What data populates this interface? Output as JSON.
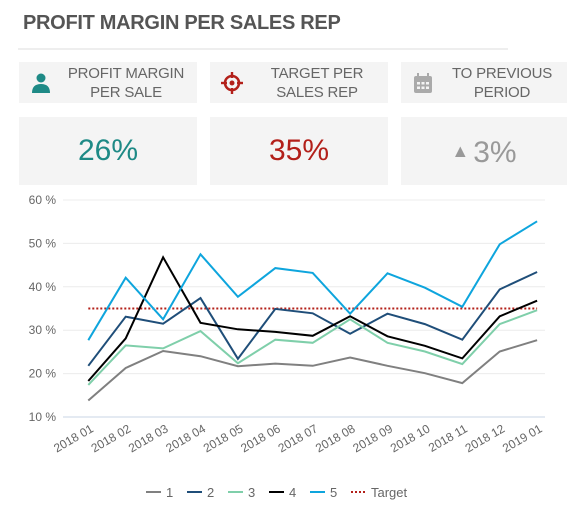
{
  "header": {
    "title": "PROFIT MARGIN PER SALES REP"
  },
  "kpis": [
    {
      "icon": "person-icon",
      "label_line1": "PROFIT MARGIN",
      "label_line2": "PER SALE",
      "value": "26%",
      "color": "#1e8a86"
    },
    {
      "icon": "target-icon",
      "label_line1": "TARGET PER",
      "label_line2": "SALES REP",
      "value": "35%",
      "color": "#b3201a"
    },
    {
      "icon": "calendar-icon",
      "label_line1": "TO PREVIOUS",
      "label_line2": "PERIOD",
      "value": "3%",
      "trend": "up",
      "color": "#999999"
    }
  ],
  "chart_data": {
    "type": "line",
    "title": "",
    "xlabel": "",
    "ylabel": "",
    "ylim": [
      10,
      60
    ],
    "yticks": [
      10,
      20,
      30,
      40,
      50,
      60
    ],
    "ytick_labels": [
      "10 %",
      "20 %",
      "30 %",
      "40 %",
      "50 %",
      "60 %"
    ],
    "grid": true,
    "legend_position": "bottom",
    "categories": [
      "2018 01",
      "2018 02",
      "2018 03",
      "2018 04",
      "2018 05",
      "2018 06",
      "2018 07",
      "2018 08",
      "2018 09",
      "2018 10",
      "2018 11",
      "2018 12",
      "2019 01"
    ],
    "series": [
      {
        "name": "1",
        "color": "#808080",
        "values": [
          13.8,
          21.3,
          25.2,
          24.0,
          21.7,
          22.3,
          21.8,
          23.7,
          21.8,
          20.1,
          17.8,
          25.1,
          27.7
        ]
      },
      {
        "name": "2",
        "color": "#1f4e79",
        "values": [
          21.8,
          33.1,
          31.5,
          37.4,
          23.4,
          34.9,
          33.9,
          29.2,
          33.8,
          31.4,
          27.8,
          39.4,
          43.4
        ]
      },
      {
        "name": "3",
        "color": "#7fcfaa",
        "values": [
          17.4,
          26.5,
          25.8,
          29.8,
          22.4,
          27.8,
          27.1,
          32.5,
          27.1,
          25.1,
          22.2,
          31.4,
          34.6
        ]
      },
      {
        "name": "4",
        "color": "#000000",
        "values": [
          18.3,
          28.1,
          46.8,
          31.7,
          30.2,
          29.6,
          28.7,
          33.2,
          28.6,
          26.4,
          23.5,
          33.2,
          36.8
        ]
      },
      {
        "name": "5",
        "color": "#0ea5dd",
        "values": [
          27.7,
          42.1,
          32.5,
          47.5,
          37.7,
          44.3,
          43.2,
          33.8,
          43.1,
          39.8,
          35.4,
          49.8,
          55.1
        ]
      }
    ],
    "target": {
      "name": "Target",
      "value": 35,
      "color": "#b3201a",
      "style": "dotted"
    }
  }
}
